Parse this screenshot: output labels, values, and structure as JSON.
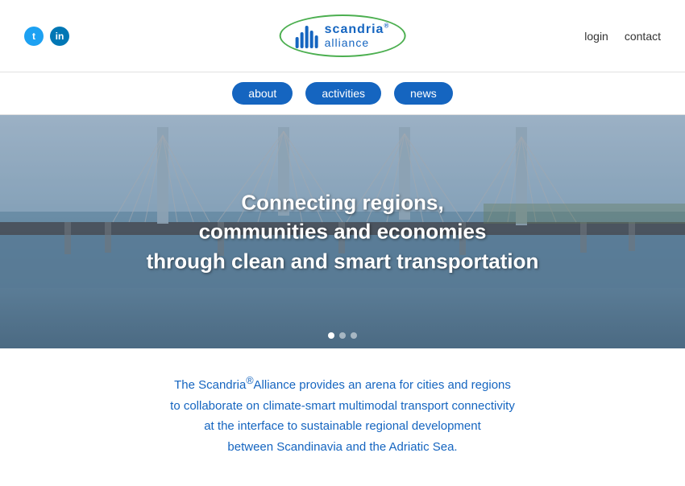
{
  "header": {
    "login_label": "login",
    "contact_label": "contact",
    "logo_top": "scandria",
    "logo_reg": "®",
    "logo_bottom": "alliance"
  },
  "social": {
    "twitter_label": "t",
    "linkedin_label": "in"
  },
  "nav": {
    "items": [
      {
        "label": "about"
      },
      {
        "label": "activities"
      },
      {
        "label": "news"
      }
    ]
  },
  "hero": {
    "title": "Connecting regions,\ncommunities and economies\nthrough clean and smart transportation"
  },
  "description": {
    "text": "The Scandria®Alliance provides an arena for cities and regions\nto collaborate on climate-smart multimodal transport connectivity\nat the interface to sustainable regional development\nbetween Scandinavia and the Adriatic Sea."
  }
}
